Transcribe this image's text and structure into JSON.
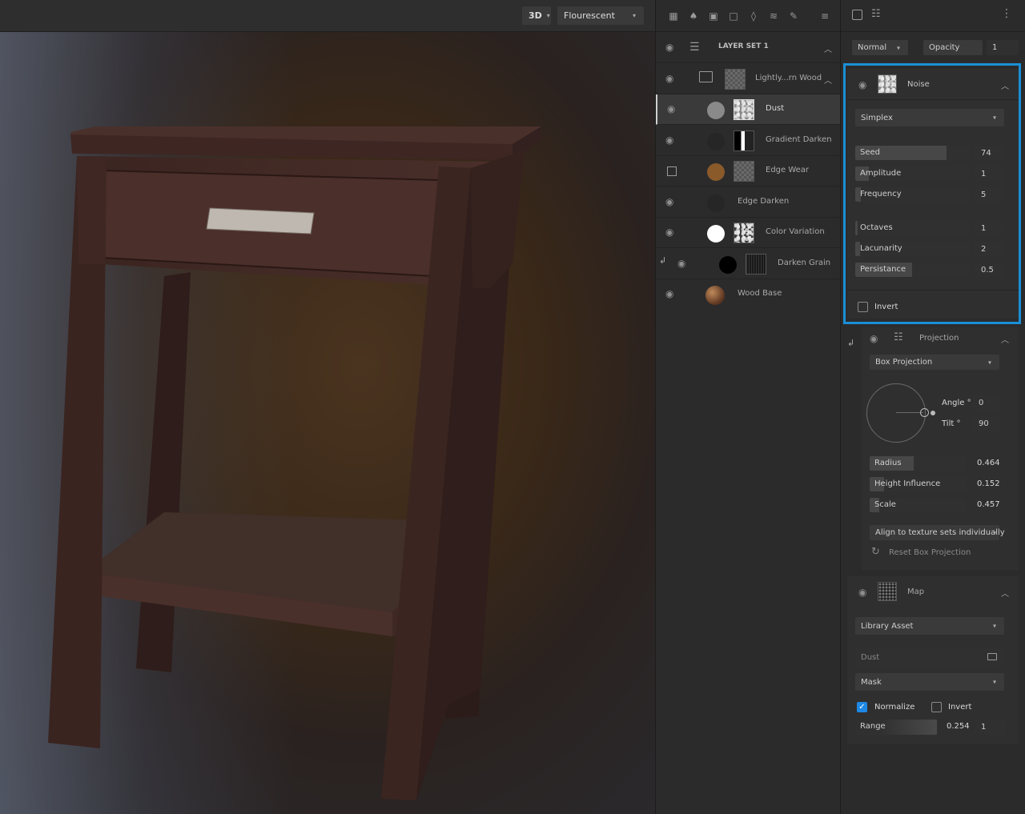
{
  "viewport": {
    "mode": "3D",
    "lighting": "Flourescent"
  },
  "layers": {
    "set_title": "LAYER SET 1",
    "folder": "Lightly...rn Wood",
    "items": [
      {
        "name": "Dust"
      },
      {
        "name": "Gradient Darken"
      },
      {
        "name": "Edge Wear"
      },
      {
        "name": "Edge Darken"
      },
      {
        "name": "Color Variation"
      },
      {
        "name": "Darken Grain"
      },
      {
        "name": "Wood Base"
      }
    ]
  },
  "props": {
    "blend_mode": "Normal",
    "opacity_label": "Opacity",
    "opacity_value": "1",
    "noise": {
      "title": "Noise",
      "type": "Simplex",
      "params": [
        {
          "label": "Seed",
          "value": "74",
          "fill": 0.8
        },
        {
          "label": "Amplitude",
          "value": "1",
          "fill": 0.12
        },
        {
          "label": "Frequency",
          "value": "5",
          "fill": 0.05
        },
        {
          "label": "Octaves",
          "value": "1",
          "fill": 0.02
        },
        {
          "label": "Lacunarity",
          "value": "2",
          "fill": 0.04
        },
        {
          "label": "Persistance",
          "value": "0.5",
          "fill": 0.5
        }
      ],
      "invert_label": "Invert"
    },
    "projection": {
      "title": "Projection",
      "type": "Box Projection",
      "angle_label": "Angle °",
      "angle_value": "0",
      "tilt_label": "Tilt °",
      "tilt_value": "90",
      "params": [
        {
          "label": "Radius",
          "value": "0.464",
          "fill": 0.46
        },
        {
          "label": "Height Influence",
          "value": "0.152",
          "fill": 0.15
        },
        {
          "label": "Scale",
          "value": "0.457",
          "fill": 0.1
        }
      ],
      "align_label": "Align to texture sets individually",
      "reset_label": "Reset Box Projection"
    },
    "map": {
      "title": "Map",
      "source": "Library Asset",
      "asset": "Dust",
      "channel": "Mask",
      "normalize_label": "Normalize",
      "invert_label": "Invert",
      "range_label": "Range",
      "range_min": "0.254",
      "range_max": "1"
    }
  },
  "colors": {
    "accent": "#1a8fd6",
    "panel": "#2b2b2c"
  }
}
